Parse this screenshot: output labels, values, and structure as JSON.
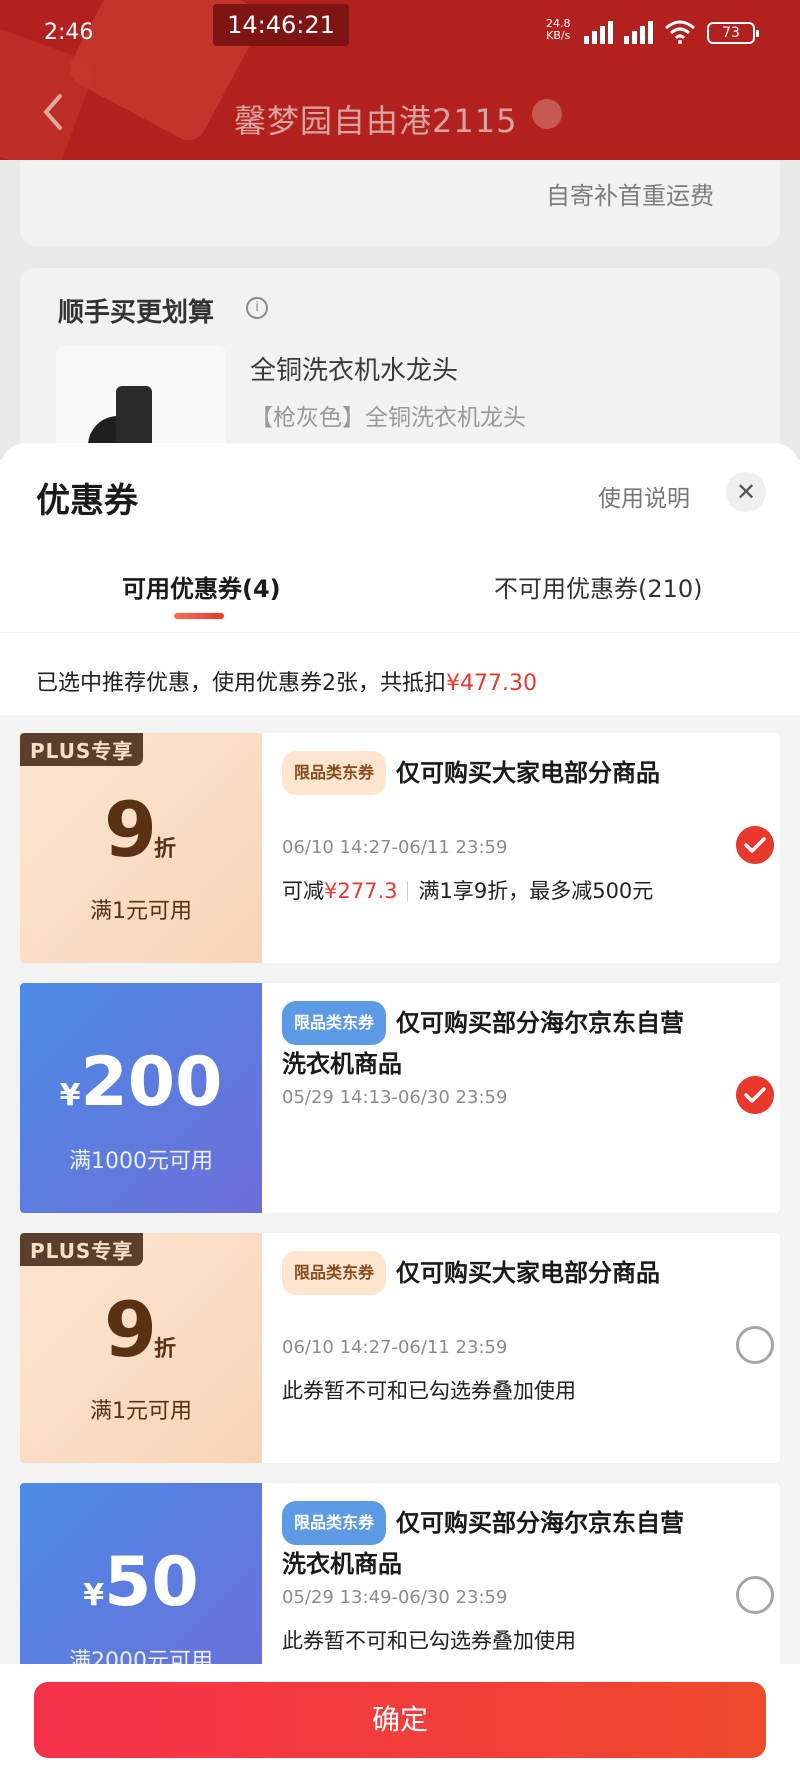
{
  "status_bar": {
    "time": "2:46",
    "center_time": "14:46:21",
    "net_speed": "24.8",
    "net_unit": "KB/s",
    "battery": "73"
  },
  "header": {
    "title": "馨梦园自由港2115"
  },
  "background": {
    "shipping_note": "自寄补首重运费",
    "section_title": "顺手买更划算",
    "product_name": "全铜洗衣机水龙头",
    "product_spec": "【枪灰色】全铜洗衣机龙头"
  },
  "sheet": {
    "title": "优惠券",
    "help_link": "使用说明",
    "tabs": [
      {
        "label": "可用优惠券(4)"
      },
      {
        "label": "不可用优惠券(210)"
      }
    ],
    "summary_text": "已选中推荐优惠，使用优惠券2张，共抵扣",
    "summary_amount": "¥477.30",
    "confirm": "确定"
  },
  "coupons": [
    {
      "tag": "PLUS专享",
      "discount": "9",
      "discount_unit": "折",
      "condition": "满1元可用",
      "badge": "限品类东券",
      "title": "仅可购买大家电部分商品",
      "date": "06/10 14:27-06/11 23:59",
      "reduce_label": "可减",
      "reduce_amount": "¥277.3",
      "rule": "满1享9折，最多减500元",
      "checked": true
    },
    {
      "yen": "¥",
      "amount": "200",
      "condition": "满1000元可用",
      "badge": "限品类东券",
      "title": "仅可购买部分海尔京东自营洗衣机商品",
      "date": "05/29 14:13-06/30 23:59",
      "checked": true
    },
    {
      "tag": "PLUS专享",
      "discount": "9",
      "discount_unit": "折",
      "condition": "满1元可用",
      "badge": "限品类东券",
      "title": "仅可购买大家电部分商品",
      "date": "06/10 14:27-06/11 23:59",
      "note": "此券暂不可和已勾选券叠加使用",
      "checked": false
    },
    {
      "yen": "¥",
      "amount": "50",
      "condition": "满2000元可用",
      "badge": "限品类东券",
      "title": "仅可购买部分海尔京东自营洗衣机商品",
      "date": "05/29 13:49-06/30 23:59",
      "note": "此券暂不可和已勾选券叠加使用",
      "checked": false
    }
  ],
  "colors": {
    "header_red": "#b3211f",
    "accent_red": "#e8382c",
    "plus_brown": "#5a3112",
    "coupon_blue": "#4c8be6"
  }
}
